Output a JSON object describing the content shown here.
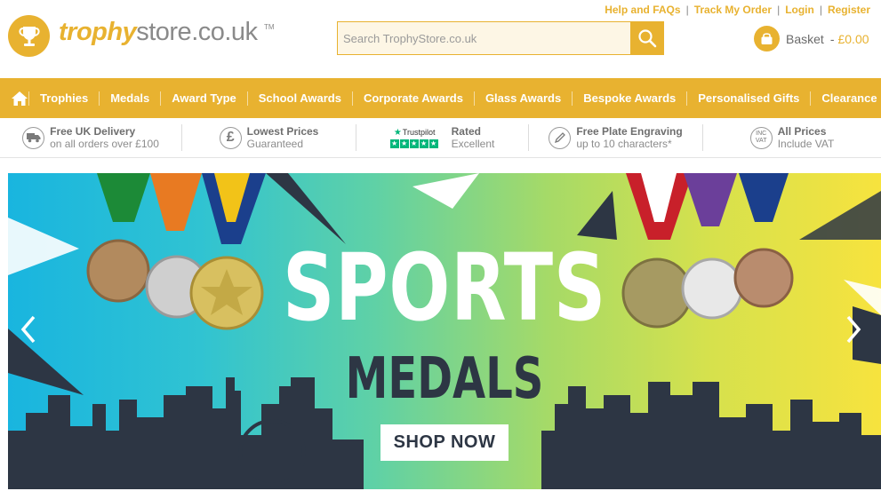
{
  "top_links": [
    "Help and FAQs",
    "Track My Order",
    "Login",
    "Register"
  ],
  "logo": {
    "part1": "trophy",
    "part2": "store.co.uk",
    "tm": "TM"
  },
  "search": {
    "placeholder": "Search TrophyStore.co.uk"
  },
  "basket": {
    "label": "Basket",
    "separator": "-",
    "amount": "£0.00"
  },
  "nav": [
    "Trophies",
    "Medals",
    "Award Type",
    "School Awards",
    "Corporate Awards",
    "Glass Awards",
    "Bespoke Awards",
    "Personalised Gifts",
    "Clearance"
  ],
  "usp": [
    {
      "title": "Free UK Delivery",
      "sub": "on all orders over £100",
      "icon": "truck-icon"
    },
    {
      "title": "Lowest Prices",
      "sub": "Guaranteed",
      "icon": "pound-icon"
    },
    {
      "title": "Rated",
      "sub": "Excellent",
      "icon": "trustpilot-icon",
      "brand": "Trustpilot"
    },
    {
      "title": "Free Plate Engraving",
      "sub": "up to 10 characters*",
      "icon": "engraving-pen-icon"
    },
    {
      "title": "All Prices",
      "sub": "Include VAT",
      "icon": "inc-vat-icon",
      "icon_text": "INC VAT"
    }
  ],
  "banner": {
    "headline": "SPORTS",
    "subheadline": "MEDALS",
    "button": "SHOP NOW"
  },
  "colors": {
    "brand": "#e8b230",
    "dark": "#2d3644",
    "trustpilot": "#00b67a"
  }
}
